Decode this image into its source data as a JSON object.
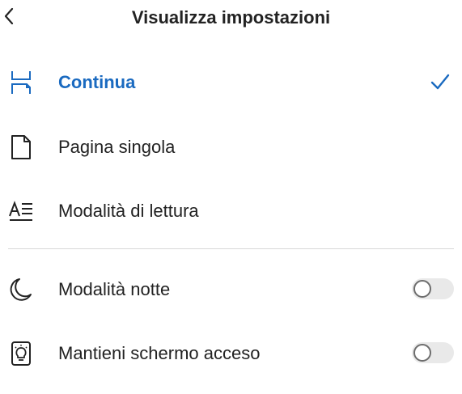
{
  "header": {
    "title": "Visualizza impostazioni",
    "back_icon": "chevron-left-icon"
  },
  "accent_color": "#1A6AC0",
  "view_modes": [
    {
      "label": "Continua",
      "icon": "continuous-scroll-icon",
      "selected": true
    },
    {
      "label": "Pagina singola",
      "icon": "single-page-icon",
      "selected": false
    },
    {
      "label": "Modalità di lettura",
      "icon": "reading-mode-icon",
      "selected": false
    }
  ],
  "toggles": [
    {
      "label": "Modalità notte",
      "icon": "moon-icon",
      "on": false
    },
    {
      "label": "Mantieni schermo acceso",
      "icon": "lightbulb-icon",
      "on": false
    }
  ]
}
